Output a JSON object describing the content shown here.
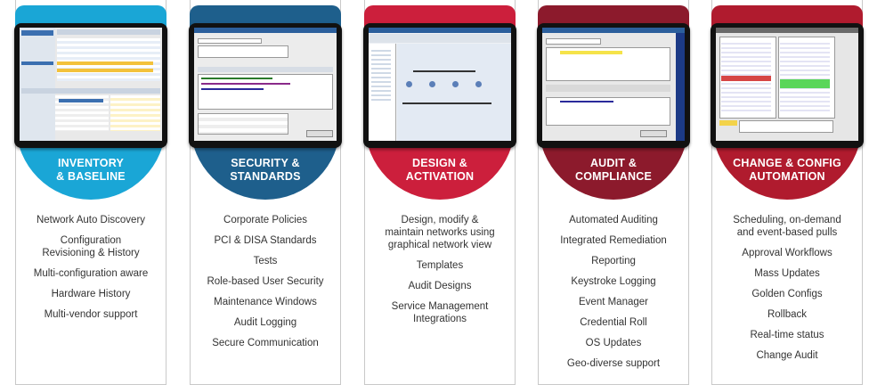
{
  "columns": [
    {
      "id": "inventory",
      "color": "#1aa6d6",
      "title": "INVENTORY\n& BASELINE",
      "features": [
        "Network Auto Discovery",
        "Configuration\nRevisioning & History",
        "Multi-configuration aware",
        "Hardware History",
        "Multi-vendor support"
      ]
    },
    {
      "id": "security",
      "color": "#1e5f8c",
      "title": "SECURITY &\nSTANDARDS",
      "features": [
        "Corporate Policies",
        "PCI & DISA Standards",
        "Tests",
        "Role-based User Security",
        "Maintenance Windows",
        "Audit Logging",
        "Secure Communication"
      ]
    },
    {
      "id": "design",
      "color": "#cc1f3c",
      "title": "DESIGN &\nACTIVATION",
      "features": [
        "Design, modify &\nmaintain networks using\ngraphical network view",
        "Templates",
        "Audit Designs",
        "Service Management\nIntegrations"
      ]
    },
    {
      "id": "audit",
      "color": "#8c1a2c",
      "title": "AUDIT &\nCOMPLIANCE",
      "features": [
        "Automated Auditing",
        "Integrated Remediation",
        "Reporting",
        "Keystroke Logging",
        "Event Manager",
        "Credential Roll",
        "OS Updates",
        "Geo-diverse support"
      ]
    },
    {
      "id": "change",
      "color": "#b01b2e",
      "title": "CHANGE & CONFIG\nAUTOMATION",
      "features": [
        "Scheduling, on-demand\nand event-based pulls",
        "Approval Workflows",
        "Mass Updates",
        "Golden Configs",
        "Rollback",
        "Real-time status",
        "Change Audit"
      ]
    }
  ]
}
